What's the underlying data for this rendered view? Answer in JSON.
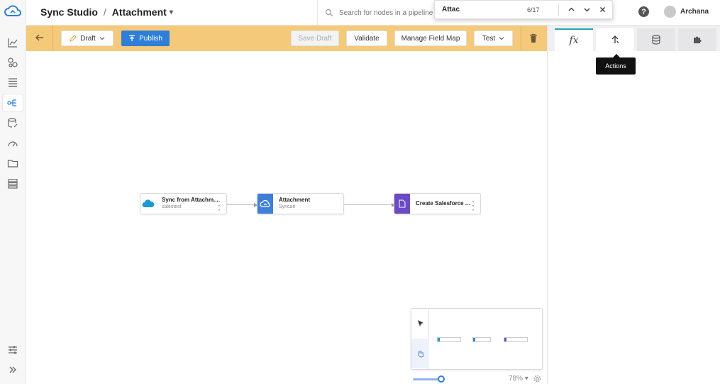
{
  "app": {
    "section": "Sync Studio",
    "page": "Attachment"
  },
  "search": {
    "placeholder": "Search for nodes in a pipeline"
  },
  "find": {
    "query": "Attac",
    "count": "6/17"
  },
  "user": {
    "name": "Archana"
  },
  "help": {
    "symbol": "?"
  },
  "toolbar": {
    "draft_label": "Draft",
    "publish_label": "Publish",
    "save_draft_label": "Save Draft",
    "validate_label": "Validate",
    "manage_field_map_label": "Manage Field Map",
    "test_label": "Test"
  },
  "nodes": [
    {
      "title": "Sync from Attachm...",
      "subtitle": "salestest",
      "icon": "salesforce-cloud-icon"
    },
    {
      "title": "Attachment",
      "subtitle": "Syncari",
      "icon": "syncari-cloud-icon"
    },
    {
      "title": "Create Salesforce ...",
      "subtitle": "",
      "icon": "document-icon"
    }
  ],
  "minimap": {
    "zoom": "78%"
  },
  "right_panel": {
    "tabs": [
      {
        "label": "fx",
        "icon": "function-icon"
      },
      {
        "label": "",
        "icon": "actions-icon"
      },
      {
        "label": "",
        "icon": "database-icon"
      },
      {
        "label": "",
        "icon": "puzzle-icon"
      }
    ],
    "tooltip": "Actions"
  },
  "colors": {
    "accent": "#2f7ed8",
    "toolbar_bg": "#f5c97a",
    "tab_accent": "#2aa2b8"
  }
}
